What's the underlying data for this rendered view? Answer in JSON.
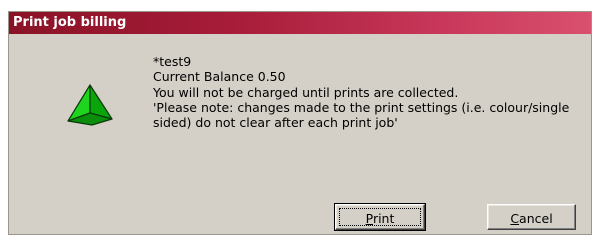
{
  "window": {
    "title": "Print job billing"
  },
  "icon": {
    "name": "green-pyramid-icon",
    "color": "#14c814"
  },
  "message": {
    "lines": [
      "*test9",
      "Current Balance 0.50",
      "You will not be charged until prints are collected.",
      "'Please note: changes made to the print settings (i.e. colour/single sided) do not clear after each print job'"
    ]
  },
  "buttons": {
    "print": {
      "accel": "P",
      "rest": "rint"
    },
    "cancel": {
      "accel": "C",
      "rest": "ancel"
    }
  }
}
